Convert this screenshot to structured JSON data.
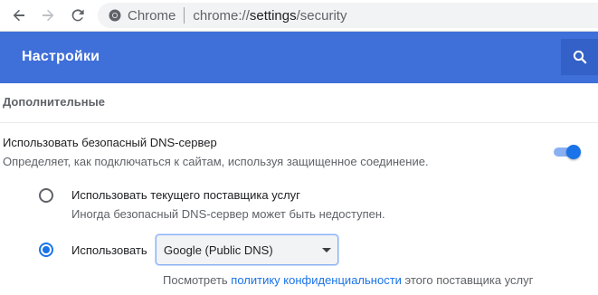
{
  "browser": {
    "site_name": "Chrome",
    "url_scheme": "chrome://",
    "url_host": "settings",
    "url_path": "/security"
  },
  "header": {
    "title": "Настройки",
    "search_icon": "search-icon"
  },
  "section": {
    "title": "Дополнительные"
  },
  "secure_dns": {
    "title": "Использовать безопасный DNS-сервер",
    "description": "Определяет, как подключаться к сайтам, используя защищенное соединение.",
    "toggle_on": true,
    "option_current": {
      "label": "Использовать текущего поставщика услуг",
      "description": "Иногда безопасный DNS-сервер может быть недоступен.",
      "selected": false
    },
    "option_custom": {
      "label": "Использовать",
      "selected": true,
      "provider": "Google (Public DNS)"
    },
    "privacy_prefix": "Посмотреть",
    "privacy_link": "политику конфиденциальности",
    "privacy_suffix": "этого поставщика услуг"
  },
  "colors": {
    "header_bg": "#3f6fd8",
    "accent": "#1a73e8"
  }
}
